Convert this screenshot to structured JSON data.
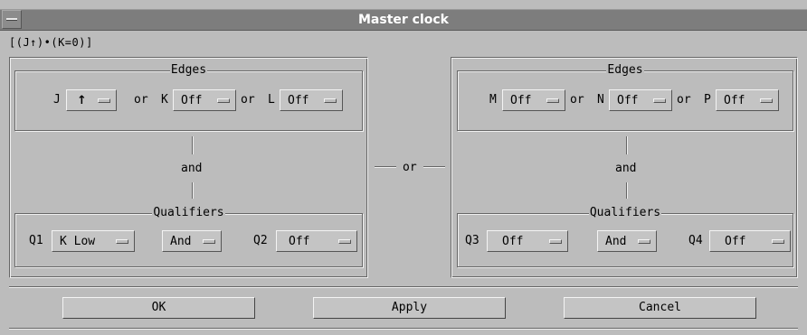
{
  "window": {
    "title": "Master clock"
  },
  "expression": "[(J↑)•(K=0)]",
  "left": {
    "edges_title": "Edges",
    "edges": [
      {
        "label": "J",
        "value": "↑"
      },
      {
        "label": "K",
        "value": "Off"
      },
      {
        "label": "L",
        "value": "Off"
      }
    ],
    "or_label": "or",
    "and_label": "and",
    "qualifiers_title": "Qualifiers",
    "q_first_label": "Q1",
    "q_first_value": "K Low",
    "combine_value": "And",
    "q_second_label": "Q2",
    "q_second_value": "Off"
  },
  "middle_or": "or",
  "right": {
    "edges_title": "Edges",
    "edges": [
      {
        "label": "M",
        "value": "Off"
      },
      {
        "label": "N",
        "value": "Off"
      },
      {
        "label": "P",
        "value": "Off"
      }
    ],
    "or_label": "or",
    "and_label": "and",
    "qualifiers_title": "Qualifiers",
    "q_first_label": "Q3",
    "q_first_value": "Off",
    "combine_value": "And",
    "q_second_label": "Q4",
    "q_second_value": "Off"
  },
  "buttons": {
    "ok": "OK",
    "apply": "Apply",
    "cancel": "Cancel"
  }
}
